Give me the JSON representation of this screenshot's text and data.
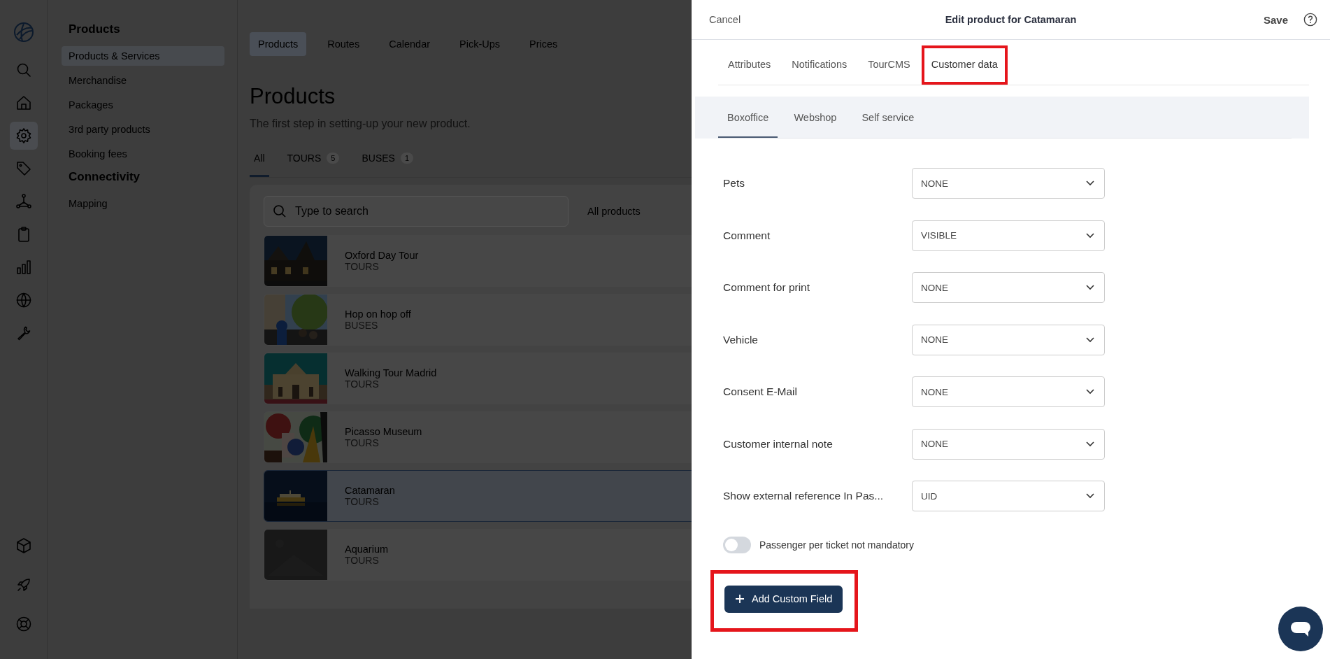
{
  "rail": {
    "top_icons": [
      {
        "kind": "search",
        "selected": false
      },
      {
        "kind": "home",
        "selected": false
      },
      {
        "kind": "gear",
        "selected": true
      },
      {
        "kind": "tag",
        "selected": false
      },
      {
        "kind": "network",
        "selected": false
      },
      {
        "kind": "clipboard",
        "selected": false
      },
      {
        "kind": "chart",
        "selected": false
      },
      {
        "kind": "globe",
        "selected": false
      },
      {
        "kind": "wrench",
        "selected": false
      }
    ],
    "bottom_icons": [
      {
        "kind": "cube",
        "selected": false
      },
      {
        "kind": "rocket",
        "selected": false
      },
      {
        "kind": "lifebuoy",
        "selected": false
      }
    ]
  },
  "sidebar": {
    "sections": [
      {
        "title": "Products",
        "items": [
          {
            "label": "Products & Services",
            "selected": true
          },
          {
            "label": "Merchandise",
            "selected": false
          },
          {
            "label": "Packages",
            "selected": false
          },
          {
            "label": "3rd party products",
            "selected": false
          },
          {
            "label": "Booking fees",
            "selected": false
          }
        ]
      },
      {
        "title": "Connectivity",
        "items": [
          {
            "label": "Mapping",
            "selected": false
          }
        ]
      }
    ]
  },
  "top_tabs": [
    {
      "label": "Products",
      "selected": true
    },
    {
      "label": "Routes",
      "selected": false
    },
    {
      "label": "Calendar",
      "selected": false
    },
    {
      "label": "Pick-Ups",
      "selected": false
    },
    {
      "label": "Prices",
      "selected": false
    }
  ],
  "page": {
    "title": "Products",
    "subtitle": "The first step in setting-up your new product."
  },
  "filter_tabs": [
    {
      "label": "All",
      "selected": true
    },
    {
      "label": "TOURS",
      "count": "5",
      "selected": false
    },
    {
      "label": "BUSES",
      "count": "1",
      "selected": false
    }
  ],
  "search": {
    "placeholder": "Type to search"
  },
  "type_filter": "All products",
  "products": [
    {
      "name": "Oxford Day Tour",
      "category": "TOURS",
      "kind": "picture",
      "selected": false
    },
    {
      "name": "Hop on hop off",
      "category": "BUSES",
      "kind": "picture",
      "selected": false
    },
    {
      "name": "Walking Tour Madrid",
      "category": "TOURS",
      "kind": "picture",
      "selected": false
    },
    {
      "name": "Picasso Museum",
      "category": "TOURS",
      "kind": "picture",
      "selected": false
    },
    {
      "name": "Catamaran",
      "category": "TOURS",
      "kind": "picture",
      "selected": true
    },
    {
      "name": "Aquarium",
      "category": "TOURS",
      "kind": "placeholder",
      "selected": false
    }
  ],
  "drawer": {
    "cancel": "Cancel",
    "title": "Edit product for Catamaran",
    "save": "Save",
    "tabs": [
      {
        "label": "Attributes",
        "selected": false,
        "highlighted": false
      },
      {
        "label": "Notifications",
        "selected": false,
        "highlighted": false
      },
      {
        "label": "TourCMS",
        "selected": false,
        "highlighted": false
      },
      {
        "label": "Customer data",
        "selected": true,
        "highlighted": true
      }
    ],
    "sub_tabs": [
      {
        "label": "Boxoffice",
        "selected": true
      },
      {
        "label": "Webshop",
        "selected": false
      },
      {
        "label": "Self service",
        "selected": false
      }
    ],
    "fields": [
      {
        "label": "Pets",
        "value": "NONE"
      },
      {
        "label": "Comment",
        "value": "VISIBLE"
      },
      {
        "label": "Comment for print",
        "value": "NONE"
      },
      {
        "label": "Vehicle",
        "value": "NONE"
      },
      {
        "label": "Consent E-Mail",
        "value": "NONE"
      },
      {
        "label": "Customer internal note",
        "value": "NONE"
      },
      {
        "label": "Show external reference In Pas...",
        "value": "UID"
      }
    ],
    "toggle": {
      "label": "Passenger per ticket not mandatory",
      "on": false
    },
    "add_button": {
      "label": "Add Custom Field",
      "highlighted": true
    }
  }
}
